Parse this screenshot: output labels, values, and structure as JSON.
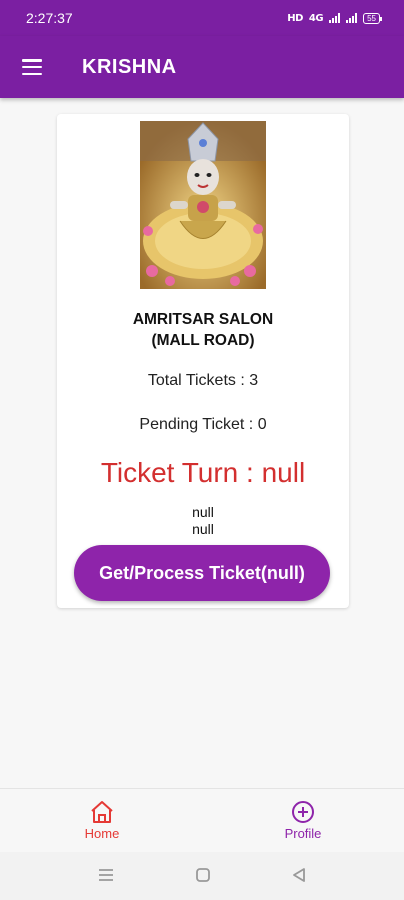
{
  "status_bar": {
    "time": "2:27:37",
    "network_label": "HD",
    "network_type": "4G",
    "battery": "55"
  },
  "app_bar": {
    "title": "KRISHNA",
    "menu_icon": "hamburger-menu-icon"
  },
  "card": {
    "image_subject": "Krishna idol",
    "salon_name_line1": "AMRITSAR SALON",
    "salon_name_line2": "(MALL ROAD)",
    "total_tickets": "Total Tickets : 3",
    "pending_ticket": "Pending Ticket : 0",
    "ticket_turn": "Ticket Turn : null",
    "null_line1": "null",
    "null_line2": "null",
    "process_button_label": "Get/Process Ticket(null)"
  },
  "bottom_nav": {
    "home_label": "Home",
    "profile_label": "Profile",
    "home_icon": "home-icon",
    "profile_icon": "add-circle-icon"
  },
  "colors": {
    "primary": "#7b1fa2",
    "button": "#8e24aa",
    "ticket_turn": "#d32f2f",
    "home_active": "#e53935"
  }
}
